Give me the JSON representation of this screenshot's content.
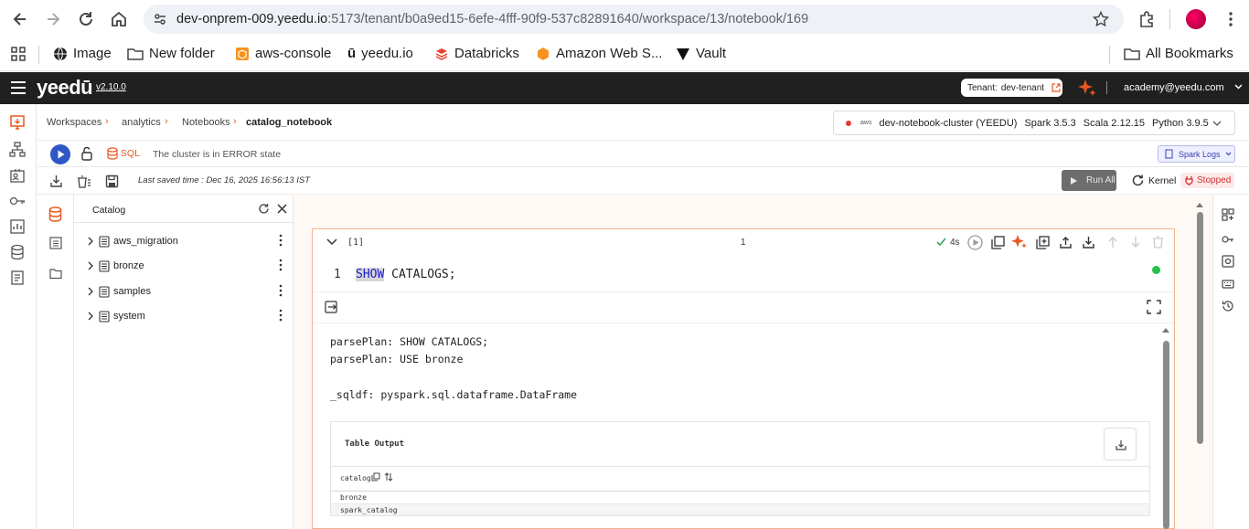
{
  "browser": {
    "url_host": "dev-onprem-009.yeedu.io",
    "url_path": ":5173/tenant/b0a9ed15-6efe-4fff-90f9-537c82891640/workspace/13/notebook/169",
    "bookmarks": [
      "Image",
      "New folder",
      "aws-console",
      "yeedu.io",
      "Databricks",
      "Amazon Web S...",
      "Vault"
    ],
    "all_bookmarks": "All Bookmarks"
  },
  "app": {
    "logo": "yeedū",
    "version": "v2.10.0",
    "tenant_label": "Tenant:",
    "tenant_name": "dev-tenant",
    "user": "academy@yeedu.com"
  },
  "breadcrumb": [
    "Workspaces",
    "analytics",
    "Notebooks",
    "catalog_notebook"
  ],
  "cluster": {
    "name": "dev-notebook-cluster (YEEDU)",
    "spark": "Spark 3.5.3",
    "scala": "Scala 2.12.15",
    "python": "Python 3.9.5",
    "status_color": "#e53935"
  },
  "toolbar": {
    "sql_label": "SQL",
    "cluster_status": "The cluster is in ERROR state",
    "spark_logs": "Spark Logs",
    "last_saved": "Last saved time : Dec 16, 2025 16:56:13 IST",
    "run_all": "Run All",
    "kernel": "Kernel",
    "kernel_status": "Stopped"
  },
  "catalog": {
    "title": "Catalog",
    "items": [
      "aws_migration",
      "bronze",
      "samples",
      "system"
    ]
  },
  "cell": {
    "index": "[1]",
    "center_label": "1",
    "duration": "4s",
    "line_number": "1",
    "code_keyword": "SHOW",
    "code_rest": " CATALOGS;",
    "output_lines": [
      "parsePlan: SHOW CATALOGS;",
      "parsePlan: USE bronze",
      "",
      "_sqldf: pyspark.sql.dataframe.DataFrame"
    ],
    "table_title": "Table Output",
    "table_column": "catalog",
    "table_rows": [
      "bronze",
      "spark_catalog"
    ]
  },
  "colors": {
    "accent": "#e8571e",
    "header_bg": "#202020",
    "run_blue": "#2f56c7"
  }
}
